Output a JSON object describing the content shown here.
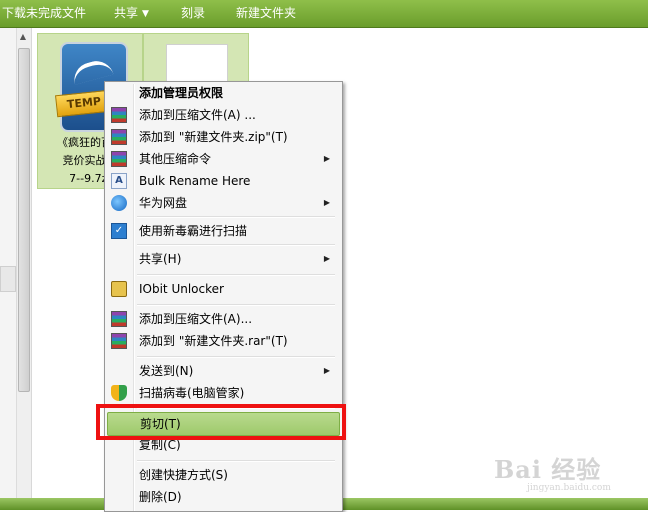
{
  "toolbar": {
    "items": [
      "下载未完成文件",
      "共享",
      "刻录",
      "新建文件夹"
    ],
    "share_arrow": "▼"
  },
  "files": [
    {
      "icon": "rar-archive-icon",
      "badge": "TEMP",
      "label_lines": [
        "《疯狂的百度",
        "竞价实战教",
        "7--9.7z."
      ]
    },
    {
      "icon": "document-icon"
    }
  ],
  "context_menu": {
    "items": [
      {
        "label": "添加管理员权限",
        "bold": true
      },
      {
        "label": "添加到压缩文件(A) ...",
        "icon": "winrar-icon"
      },
      {
        "label": "添加到 \"新建文件夹.zip\"(T)",
        "icon": "winrar-icon"
      },
      {
        "label": "其他压缩命令",
        "icon": "winrar-icon",
        "submenu": true
      },
      {
        "label": "Bulk Rename Here",
        "icon": "bulk-rename-icon",
        "icon_glyph": "A"
      },
      {
        "label": "华为网盘",
        "icon": "huawei-cloud-icon",
        "submenu": true
      },
      {
        "label": "使用新毒霸进行扫描",
        "icon": "duba-antivirus-icon",
        "icon_glyph": "✓"
      },
      {
        "label": "共享(H)",
        "submenu": true
      },
      {
        "label": "IObit Unlocker",
        "icon": "unlocker-lock-icon"
      },
      {
        "label": "添加到压缩文件(A)...",
        "icon": "winrar-icon"
      },
      {
        "label": "添加到 \"新建文件夹.rar\"(T)",
        "icon": "winrar-icon"
      },
      {
        "label": "发送到(N)",
        "submenu": true
      },
      {
        "label": "扫描病毒(电脑管家)",
        "icon": "tencent-manager-shield-icon"
      },
      {
        "label": "剪切(T)",
        "highlighted": true
      },
      {
        "label": "复制(C)"
      },
      {
        "label": "创建快捷方式(S)"
      },
      {
        "label": "删除(D)"
      }
    ],
    "submenu_arrow": "▶"
  },
  "highlight_color": "#ee1111",
  "watermark": {
    "main": "Bai 经验",
    "sub": "jingyan.baidu.com"
  }
}
